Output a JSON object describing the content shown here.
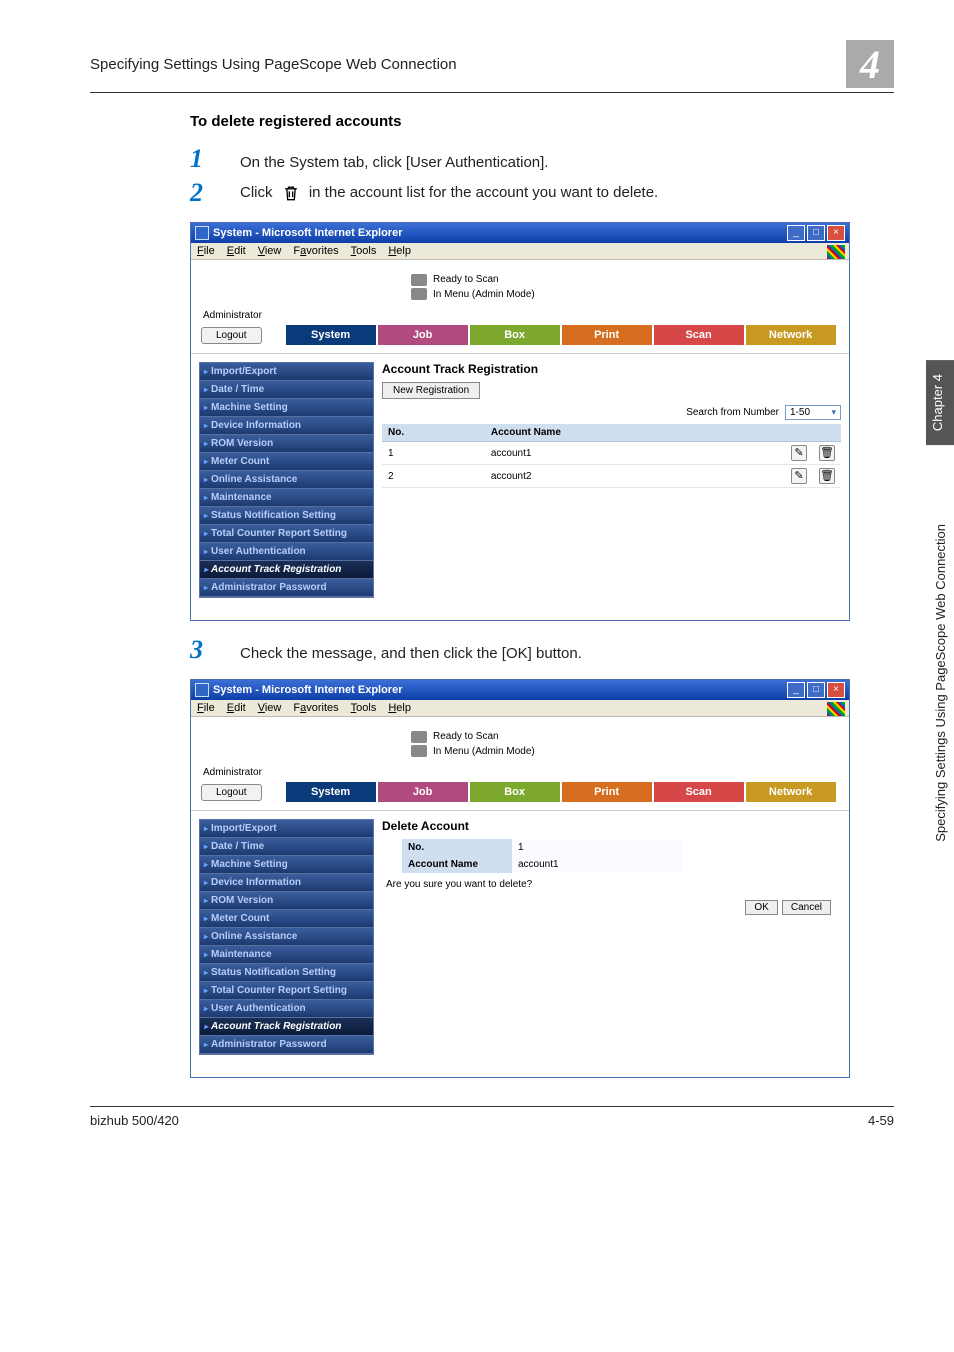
{
  "header": {
    "title": "Specifying Settings Using PageScope Web Connection",
    "chapter_num": "4"
  },
  "section_heading": "To delete registered accounts",
  "steps": {
    "s1": {
      "num": "1",
      "text": "On the System tab, click [User Authentication]."
    },
    "s2": {
      "num": "2",
      "text_before": "Click ",
      "text_after": " in the account list for the account you want to delete."
    },
    "s3": {
      "num": "3",
      "text": "Check the message, and then click the [OK] button."
    }
  },
  "browser": {
    "title": "System - Microsoft Internet Explorer",
    "menu": {
      "file": "File",
      "edit": "Edit",
      "view": "View",
      "favorites": "Favorites",
      "tools": "Tools",
      "help": "Help"
    },
    "banner": {
      "line1": "Ready to Scan",
      "line2": "In Menu (Admin Mode)"
    },
    "admin_label": "Administrator",
    "logout": "Logout",
    "tabs": {
      "system": "System",
      "job": "Job",
      "box": "Box",
      "print": "Print",
      "scan": "Scan",
      "network": "Network"
    },
    "sidebar": [
      "Import/Export",
      "Date / Time",
      "Machine Setting",
      "Device Information",
      "ROM Version",
      "Meter Count",
      "Online Assistance",
      "Maintenance",
      "Status Notification Setting",
      "Total Counter Report Setting",
      "User Authentication",
      "Account Track Registration",
      "Administrator Password"
    ],
    "panel1": {
      "title": "Account Track Registration",
      "new_registration": "New Registration",
      "search_label": "Search from Number",
      "search_value": "1-50",
      "col_no": "No.",
      "col_name": "Account Name",
      "rows": [
        {
          "no": "1",
          "name": "account1"
        },
        {
          "no": "2",
          "name": "account2"
        }
      ]
    },
    "panel2": {
      "title": "Delete Account",
      "k_no": "No.",
      "v_no": "1",
      "k_name": "Account Name",
      "v_name": "account1",
      "confirm": "Are you sure you want to delete?",
      "ok": "OK",
      "cancel": "Cancel"
    }
  },
  "sidetab": "Chapter 4",
  "sidetab_long": "Specifying Settings Using PageScope Web Connection",
  "footer": {
    "left": "bizhub 500/420",
    "right": "4-59"
  }
}
